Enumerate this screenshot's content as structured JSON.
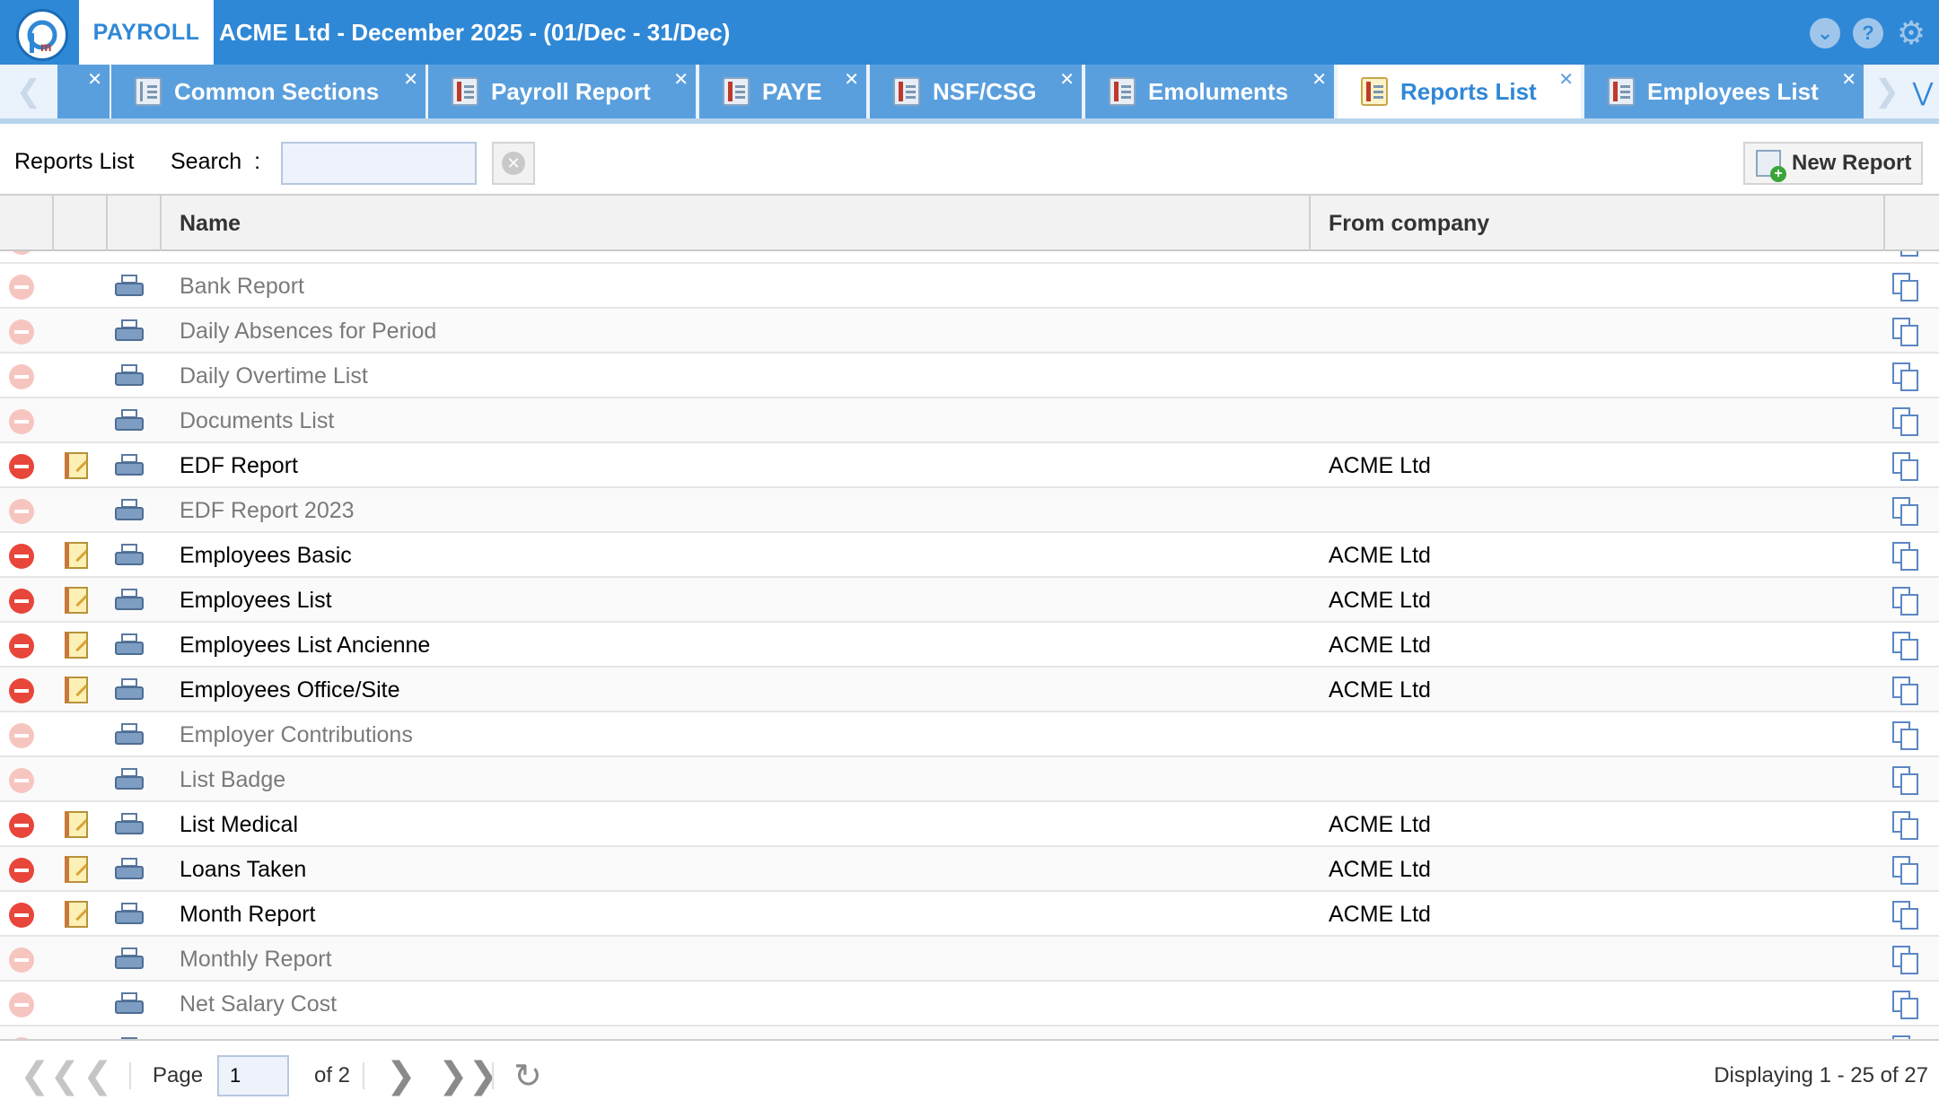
{
  "header": {
    "app_badge": "PAYROLL",
    "title": "ACME Ltd - December 2025 - (01/Dec - 31/Dec)",
    "icons": [
      "chevron-down-icon",
      "help-icon",
      "gear-icon"
    ]
  },
  "tabs": [
    {
      "label": "Common Sections",
      "icon": "gear-document-icon",
      "active": false
    },
    {
      "label": "Payroll Report",
      "icon": "report-icon",
      "active": false
    },
    {
      "label": "PAYE",
      "icon": "report-icon",
      "active": false
    },
    {
      "label": "NSF/CSG",
      "icon": "report-icon",
      "active": false
    },
    {
      "label": "Emoluments",
      "icon": "report-icon",
      "active": false
    },
    {
      "label": "Reports List",
      "icon": "report-edit-icon",
      "active": true
    },
    {
      "label": "Employees List",
      "icon": "report-icon",
      "active": false
    }
  ],
  "toolbar": {
    "title": "Reports List",
    "search_label": "Search",
    "search_colon": ":",
    "search_value": "",
    "new_report_label": "New Report"
  },
  "grid": {
    "columns": {
      "name": "Name",
      "company": "From company"
    },
    "rows": [
      {
        "name": "Bank Report",
        "company": "",
        "editable": false
      },
      {
        "name": "Daily Absences for Period",
        "company": "",
        "editable": false
      },
      {
        "name": "Daily Overtime List",
        "company": "",
        "editable": false
      },
      {
        "name": "Documents List",
        "company": "",
        "editable": false
      },
      {
        "name": "EDF Report",
        "company": "ACME Ltd",
        "editable": true
      },
      {
        "name": "EDF Report 2023",
        "company": "",
        "editable": false
      },
      {
        "name": "Employees Basic",
        "company": "ACME Ltd",
        "editable": true
      },
      {
        "name": "Employees List",
        "company": "ACME Ltd",
        "editable": true
      },
      {
        "name": "Employees List Ancienne",
        "company": "ACME Ltd",
        "editable": true
      },
      {
        "name": "Employees Office/Site",
        "company": "ACME Ltd",
        "editable": true
      },
      {
        "name": "Employer Contributions",
        "company": "",
        "editable": false
      },
      {
        "name": "List Badge",
        "company": "",
        "editable": false
      },
      {
        "name": "List Medical",
        "company": "ACME Ltd",
        "editable": true
      },
      {
        "name": "Loans Taken",
        "company": "ACME Ltd",
        "editable": true
      },
      {
        "name": "Month Report",
        "company": "ACME Ltd",
        "editable": true
      },
      {
        "name": "Monthly Report",
        "company": "",
        "editable": false
      },
      {
        "name": "Net Salary Cost",
        "company": "",
        "editable": false
      }
    ]
  },
  "paging": {
    "page_label": "Page",
    "page_value": "1",
    "of_label": "of 2",
    "display_text": "Displaying 1 - 25 of 27"
  },
  "colors": {
    "header_blue": "#2f88d6",
    "tab_blue": "#5a9fdd",
    "delete_red": "#e8463a"
  }
}
